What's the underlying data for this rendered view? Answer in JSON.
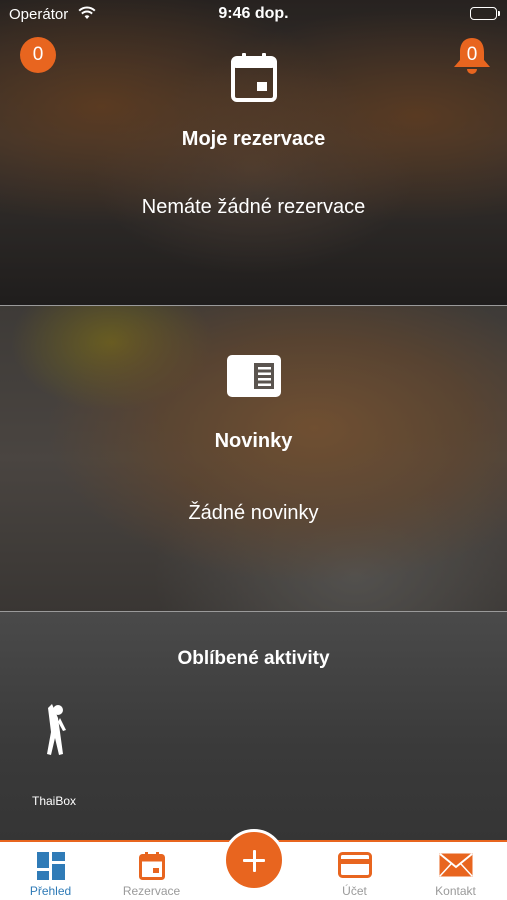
{
  "status_bar": {
    "carrier": "Operátor",
    "time": "9:46 dop."
  },
  "badges": {
    "left_count": "0",
    "notification_count": "0"
  },
  "reservations": {
    "title": "Moje rezervace",
    "empty_text": "Nemáte žádné rezervace",
    "icon": "calendar-icon"
  },
  "news": {
    "title": "Novinky",
    "empty_text": "Žádné novinky",
    "icon": "newspaper-icon"
  },
  "favorites": {
    "title": "Oblíbené aktivity",
    "items": [
      {
        "label": "ThaiBox",
        "icon": "stretching-person-icon"
      }
    ]
  },
  "tabbar": {
    "tabs": [
      {
        "label": "Přehled",
        "icon": "dashboard-icon",
        "active": true
      },
      {
        "label": "Rezervace",
        "icon": "calendar-icon",
        "active": false
      },
      {
        "label": "Účet",
        "icon": "credit-card-icon",
        "active": false
      },
      {
        "label": "Kontakt",
        "icon": "envelope-icon",
        "active": false
      }
    ],
    "add_icon": "plus-icon"
  },
  "colors": {
    "accent": "#e8651f",
    "active_tab": "#2f7bb7",
    "inactive_tab": "#9a9a9a"
  }
}
